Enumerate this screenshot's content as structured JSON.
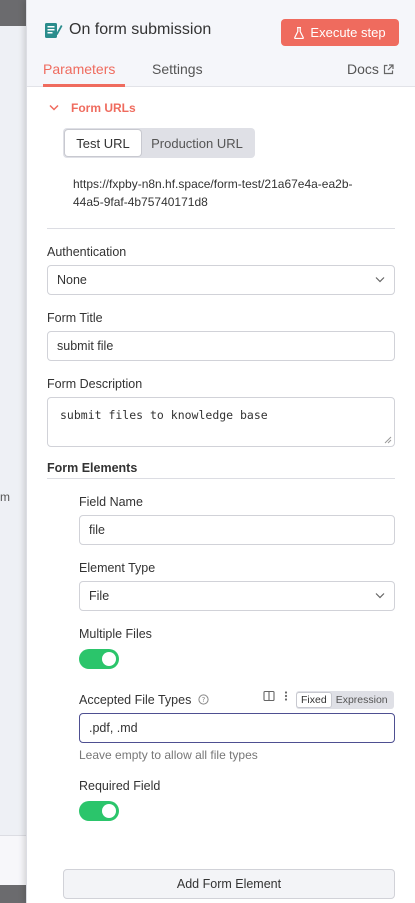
{
  "background": {
    "canvas_text": "m"
  },
  "header": {
    "title": "On form submission",
    "execute_label": "Execute step",
    "tabs": [
      "Parameters",
      "Settings"
    ],
    "docs_label": "Docs"
  },
  "form_urls": {
    "section_label": "Form URLs",
    "test_label": "Test URL",
    "production_label": "Production URL",
    "url_line1": "https://fxpby-n8n.hf.space/form-test/21a67e4a-ea2b-",
    "url_line2": "44a5-9faf-4b75740171d8"
  },
  "authentication": {
    "label": "Authentication",
    "value": "None"
  },
  "form_title": {
    "label": "Form Title",
    "value": "submit file"
  },
  "form_description": {
    "label": "Form Description",
    "value": "submit files to knowledge base"
  },
  "form_elements": {
    "label": "Form Elements",
    "field_name": {
      "label": "Field Name",
      "value": "file"
    },
    "element_type": {
      "label": "Element Type",
      "value": "File"
    },
    "multiple_files": {
      "label": "Multiple Files",
      "enabled": true
    },
    "accepted_types": {
      "label": "Accepted File Types",
      "value": ".pdf, .md",
      "hint": "Leave empty to allow all file types",
      "fixed_label": "Fixed",
      "expression_label": "Expression"
    },
    "required_field": {
      "label": "Required Field",
      "enabled": true
    },
    "add_label": "Add Form Element"
  },
  "colors": {
    "accent": "#ef6b5e",
    "toggle_on": "#2bc56b"
  }
}
